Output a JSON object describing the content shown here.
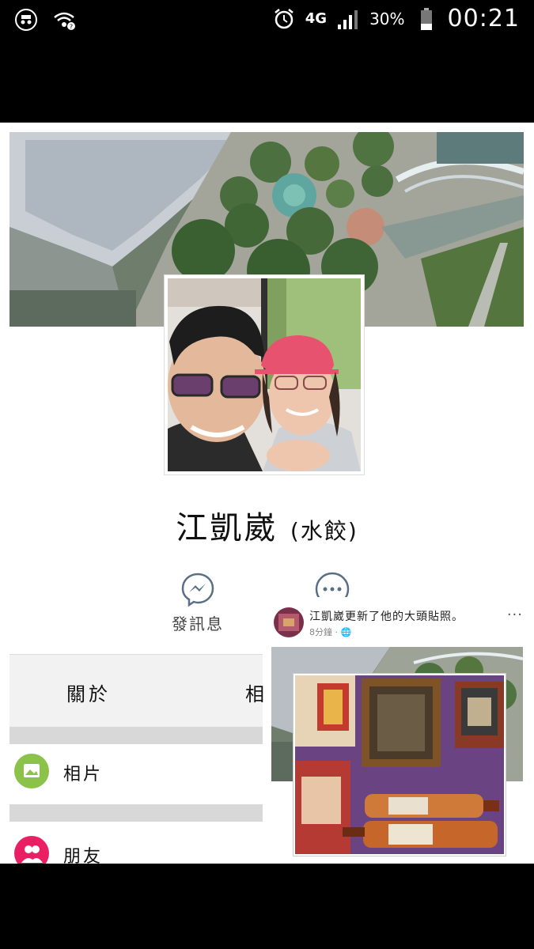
{
  "status_bar": {
    "left_icons": [
      "incognito-icon",
      "wifi-question-icon"
    ],
    "network": "4G",
    "battery_percent": "30%",
    "time": "00:21"
  },
  "profile": {
    "name": "江凱崴",
    "nickname": "(水餃)"
  },
  "actions": {
    "message_label": "發訊息"
  },
  "tabs": {
    "about": "關於",
    "photos_peek": "相"
  },
  "menu": {
    "photos": "相片",
    "friends": "朋友"
  },
  "feed": {
    "post_text": "江凱崴更新了他的大頭貼照。",
    "timestamp": "8分鐘 ·",
    "more": "···"
  },
  "colors": {
    "messenger_icon": "#5a6f86",
    "photos_icon": "#8bc34a",
    "friends_icon": "#e91e63"
  }
}
